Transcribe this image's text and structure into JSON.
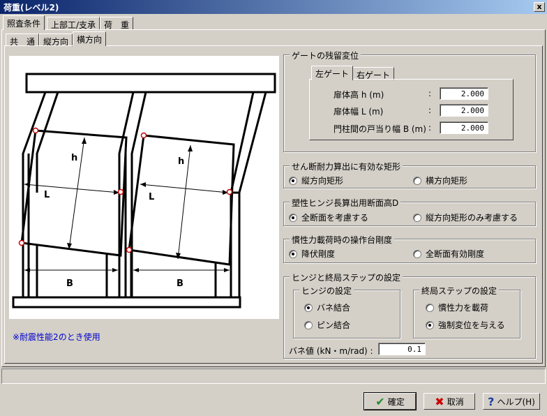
{
  "window": {
    "title": "荷重(レベル2)",
    "close_glyph": "x"
  },
  "tabs_top": [
    "照査条件",
    "上部工/支承",
    "荷　重"
  ],
  "tabs_sub": [
    "共　通",
    "縦方向",
    "横方向"
  ],
  "diagram": {
    "labels": {
      "h": "h",
      "L": "L",
      "B": "B"
    }
  },
  "note": "※耐震性能2のとき使用",
  "gate_residual": {
    "title": "ゲートの残留変位",
    "tabs": [
      "左ゲート",
      "右ゲート"
    ],
    "rows": [
      {
        "label": "扉体高 h (m)",
        "colon": ":",
        "value": "2.000"
      },
      {
        "label": "扉体幅 L (m)",
        "colon": ":",
        "value": "2.000"
      },
      {
        "label": "門柱間の戸当り幅 B (m)",
        "colon": ":",
        "value": "2.000"
      }
    ]
  },
  "shear": {
    "title": "せん断耐力算出に有効な矩形",
    "options": [
      "縦方向矩形",
      "横方向矩形"
    ],
    "selected": 0
  },
  "plastic": {
    "title": "塑性ヒンジ長算出用断面高D",
    "options": [
      "全断面を考慮する",
      "縦方向矩形のみ考慮する"
    ],
    "selected": 0
  },
  "inertia": {
    "title": "慣性力載荷時の操作台剛度",
    "options": [
      "降伏剛度",
      "全断面有効剛度"
    ],
    "selected": 0
  },
  "hinge": {
    "title": "ヒンジと終局ステップの設定",
    "hinge_group": {
      "title": "ヒンジの設定",
      "options": [
        "バネ結合",
        "ピン結合"
      ],
      "selected": 0
    },
    "step_group": {
      "title": "終局ステップの設定",
      "options": [
        "慣性力を載荷",
        "強制変位を与える"
      ],
      "selected": 1
    },
    "spring_label": "バネ値 (kN・m/rad) :",
    "spring_value": "0.1"
  },
  "buttons": {
    "ok": "確定",
    "cancel": "取消",
    "help": "ヘルプ(H)"
  },
  "colors": {
    "ok_icon": "#2a8a2a",
    "cancel_icon": "#cc0000",
    "help_icon": "#1a3fa0",
    "note": "#0000cc",
    "hinge_dot": "#cc0000"
  }
}
